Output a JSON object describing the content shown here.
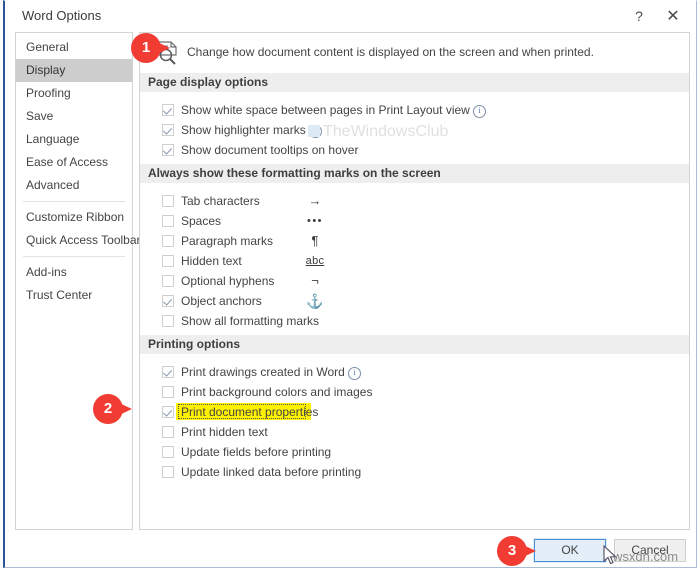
{
  "window": {
    "title": "Word Options",
    "help_label": "?",
    "close_label": "✕"
  },
  "sidebar": {
    "items": [
      {
        "label": "General",
        "selected": false
      },
      {
        "label": "Display",
        "selected": true
      },
      {
        "label": "Proofing",
        "selected": false
      },
      {
        "label": "Save",
        "selected": false
      },
      {
        "label": "Language",
        "selected": false
      },
      {
        "label": "Ease of Access",
        "selected": false
      },
      {
        "label": "Advanced",
        "selected": false
      },
      {
        "label": "Customize Ribbon",
        "selected": false
      },
      {
        "label": "Quick Access Toolbar",
        "selected": false
      },
      {
        "label": "Add-ins",
        "selected": false
      },
      {
        "label": "Trust Center",
        "selected": false
      }
    ]
  },
  "pane": {
    "description": "Change how document content is displayed on the screen and when printed.",
    "icon": "document-display-icon",
    "sections": [
      {
        "title": "Page display options",
        "options": [
          {
            "label": "Show white space between pages in Print Layout view",
            "checked": true,
            "info": true
          },
          {
            "label": "Show highlighter marks",
            "checked": true,
            "info": true
          },
          {
            "label": "Show document tooltips on hover",
            "checked": true,
            "info": false
          }
        ]
      },
      {
        "title": "Always show these formatting marks on the screen",
        "options": [
          {
            "label": "Tab characters",
            "checked": false,
            "symbol": "→"
          },
          {
            "label": "Spaces",
            "checked": false,
            "symbol": "•••"
          },
          {
            "label": "Paragraph marks",
            "checked": false,
            "symbol": "¶"
          },
          {
            "label": "Hidden text",
            "checked": false,
            "symbol": "abc"
          },
          {
            "label": "Optional hyphens",
            "checked": false,
            "symbol": "¬"
          },
          {
            "label": "Object anchors",
            "checked": true,
            "symbol": "⚓"
          },
          {
            "label": "Show all formatting marks",
            "checked": false,
            "symbol": ""
          }
        ]
      },
      {
        "title": "Printing options",
        "options": [
          {
            "label": "Print drawings created in Word",
            "checked": true,
            "info": true
          },
          {
            "label": "Print background colors and images",
            "checked": false
          },
          {
            "label": "Print document properties",
            "checked": true,
            "highlighted": true
          },
          {
            "label": "Print hidden text",
            "checked": false
          },
          {
            "label": "Update fields before printing",
            "checked": false
          },
          {
            "label": "Update linked data before printing",
            "checked": false
          }
        ]
      }
    ]
  },
  "footer": {
    "ok_label": "OK",
    "cancel_label": "Cancel"
  },
  "annotations": {
    "markers": [
      {
        "number": "1"
      },
      {
        "number": "2"
      },
      {
        "number": "3"
      }
    ]
  },
  "watermarks": {
    "center": "TheWindowsClub",
    "bottom": "wsxdn.com"
  },
  "colors": {
    "accent_blue": "#2a5699",
    "marker_red": "#f03c33",
    "highlight_yellow": "#fff200",
    "selected_nav": "#cdcdcd",
    "section_band": "#eeeeee"
  }
}
